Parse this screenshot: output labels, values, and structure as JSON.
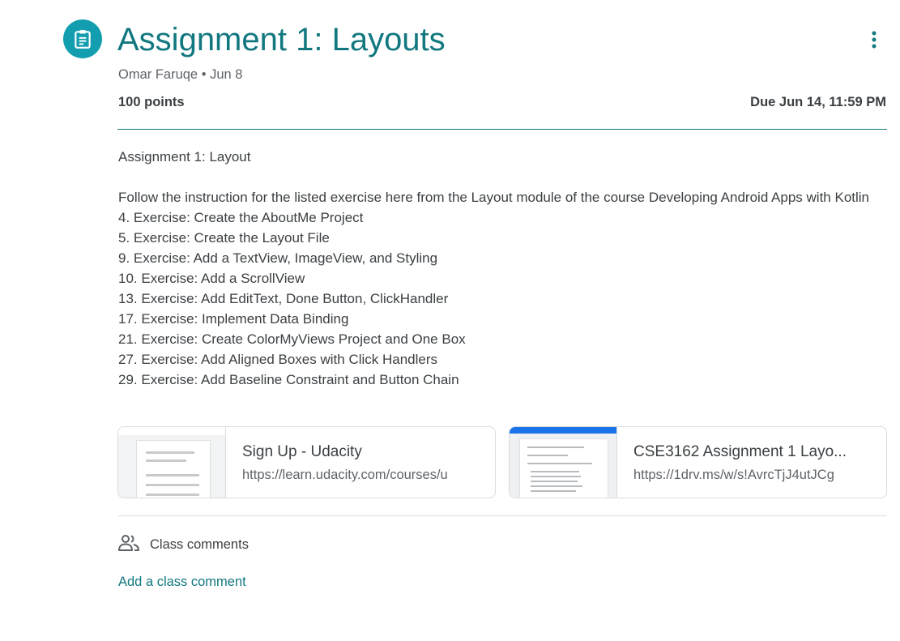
{
  "assignment": {
    "title": "Assignment 1: Layouts",
    "author": "Omar Faruqe",
    "date": "Jun 8",
    "meta_separator": " • ",
    "points": "100 points",
    "due": "Due Jun 14, 11:59 PM"
  },
  "description": {
    "heading": "Assignment 1: Layout",
    "intro": "Follow the instruction for the listed exercise here from the Layout module of the course Developing Android Apps with Kotlin",
    "exercises": [
      "4. Exercise: Create the AboutMe Project",
      "5. Exercise: Create the Layout File",
      "9. Exercise: Add a TextView, ImageView, and Styling",
      "10. Exercise: Add a ScrollView",
      "13. Exercise: Add EditText, Done Button, ClickHandler",
      "17. Exercise: Implement Data Binding",
      "21. Exercise: Create ColorMyViews Project and One Box",
      "27. Exercise: Add Aligned Boxes with Click Handlers",
      "29. Exercise: Add Baseline Constraint and Button Chain"
    ]
  },
  "attachments": [
    {
      "title": "Sign Up - Udacity",
      "url": "https://learn.udacity.com/courses/u"
    },
    {
      "title": "CSE3162 Assignment 1 Layo...",
      "url": "https://1drv.ms/w/s!AvrcTjJ4utJCg"
    }
  ],
  "comments": {
    "label": "Class comments",
    "add_label": "Add a class comment"
  },
  "icons": {
    "assignment": "assignment-icon",
    "more": "more-vert-icon",
    "people": "people-icon"
  },
  "colors": {
    "accent": "#12787f",
    "icon_bg": "#129eaf"
  }
}
